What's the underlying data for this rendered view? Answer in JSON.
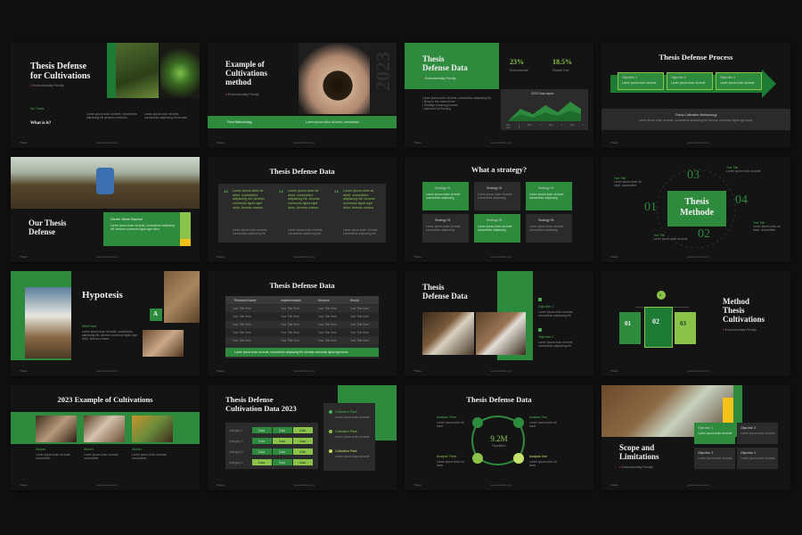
{
  "page": {
    "brand": "Thesis",
    "site": "www.website.com"
  },
  "s1": {
    "title1": "Thesis Defense",
    "title2": "for Cultivations",
    "sub": "Environmentally Friendly",
    "tag": "Our Thesis",
    "q": "What is it?"
  },
  "s2": {
    "title1": "Example of",
    "title2": "Cultivations",
    "title3": "method",
    "sub": "Environmentally Friendly",
    "bar": "Plant Methodology",
    "year": "2023"
  },
  "s3": {
    "title1": "Thesis",
    "title2": "Defense Data",
    "sub": "Environmentally Friendly",
    "v1": "23%",
    "l1": "Environmental",
    "v2": "18.5%",
    "l2": "Shaded Tree",
    "chart_title": "2023 Data report",
    "months": [
      "Item 1",
      "Item 2",
      "Item 3",
      "Item 4",
      "Item 5"
    ]
  },
  "s4": {
    "title": "Thesis Defense Process",
    "o1": "Objective 1",
    "o2": "Objective 2",
    "o3": "Objective 3",
    "bar": "Thesis Cultivation Methodology"
  },
  "s5": {
    "title1": "Our Thesis",
    "title2": "Defense",
    "box": "Garden Waste Disposal"
  },
  "s6": {
    "title": "Thesis Defense Data",
    "q": "Lorem ipsum dolor sit amet, consectetur adipiscing elit. Aenean commodo ligula eget dolor. Aenean massa.",
    "s": "Lorem ipsum dolor sit amet, consectetur adipiscing elit."
  },
  "s7": {
    "title": "What a strategy?",
    "items": [
      "Strategy 01",
      "Strategy 02",
      "Strategy 03",
      "Strategy 04",
      "Strategy 05",
      "Strategy 06"
    ]
  },
  "s8": {
    "t1": "Thesis",
    "t2": "Methode",
    "n1": "01",
    "n2": "02",
    "n3": "03",
    "n4": "04",
    "l1": "Your Title",
    "l2": "Your Title",
    "l3": "Your Title",
    "l4": "Your Title"
  },
  "s9": {
    "title": "Hypotesis",
    "badge": "A",
    "what": "What Facts"
  },
  "s10": {
    "title": "Thesis Defense Data",
    "cols": [
      "Research Name",
      "Implementation",
      "Workers",
      "Result"
    ],
    "row": [
      "Your Title Here",
      "Your Title Here",
      "Your Title Here",
      "Your Title Here"
    ],
    "bar": "Lorem ipsum dolor sit amet, consectetur adipiscing elit. Aenean commodo ligula eget dolor."
  },
  "s11": {
    "t1": "Thesis",
    "t2": "Defense Data",
    "o1": "Objective 1",
    "o2": "Objective 2"
  },
  "s12": {
    "t1": "Method",
    "t2": "Thesis",
    "t3": "Cultivations",
    "sub": "Environmentally Friendly",
    "n1": "01",
    "n2": "02",
    "n3": "03",
    "top": "A"
  },
  "s13": {
    "title": "2023 Example of Cultivations",
    "c1": "Worker",
    "c2": "Worker",
    "c3": "Worker"
  },
  "s14": {
    "t1": "Thesis Defense",
    "t2": "Cultivation Data 2023",
    "cats": [
      "Category 1",
      "Category 2",
      "Category 3",
      "Category 4"
    ],
    "cells": [
      "Data",
      "Data",
      "Data"
    ],
    "leg": [
      "Cultivation Plant",
      "Cultivation Plant",
      "Cultivation Plant"
    ]
  },
  "s15": {
    "title": "Thesis Defense Data",
    "center": "9.2M",
    "center_sub": "Population",
    "l1": "Analysis Three",
    "l2": "Analysis Two",
    "l3": "Analysis Three",
    "l4": "Analysis One"
  },
  "s16": {
    "t1": "Scope and",
    "t2": "Limitations",
    "sub": "Environmentally Friendly",
    "o1": "Objective 1",
    "o2": "Objective 2",
    "o3": "Objective 3",
    "o4": "Objective 4"
  }
}
